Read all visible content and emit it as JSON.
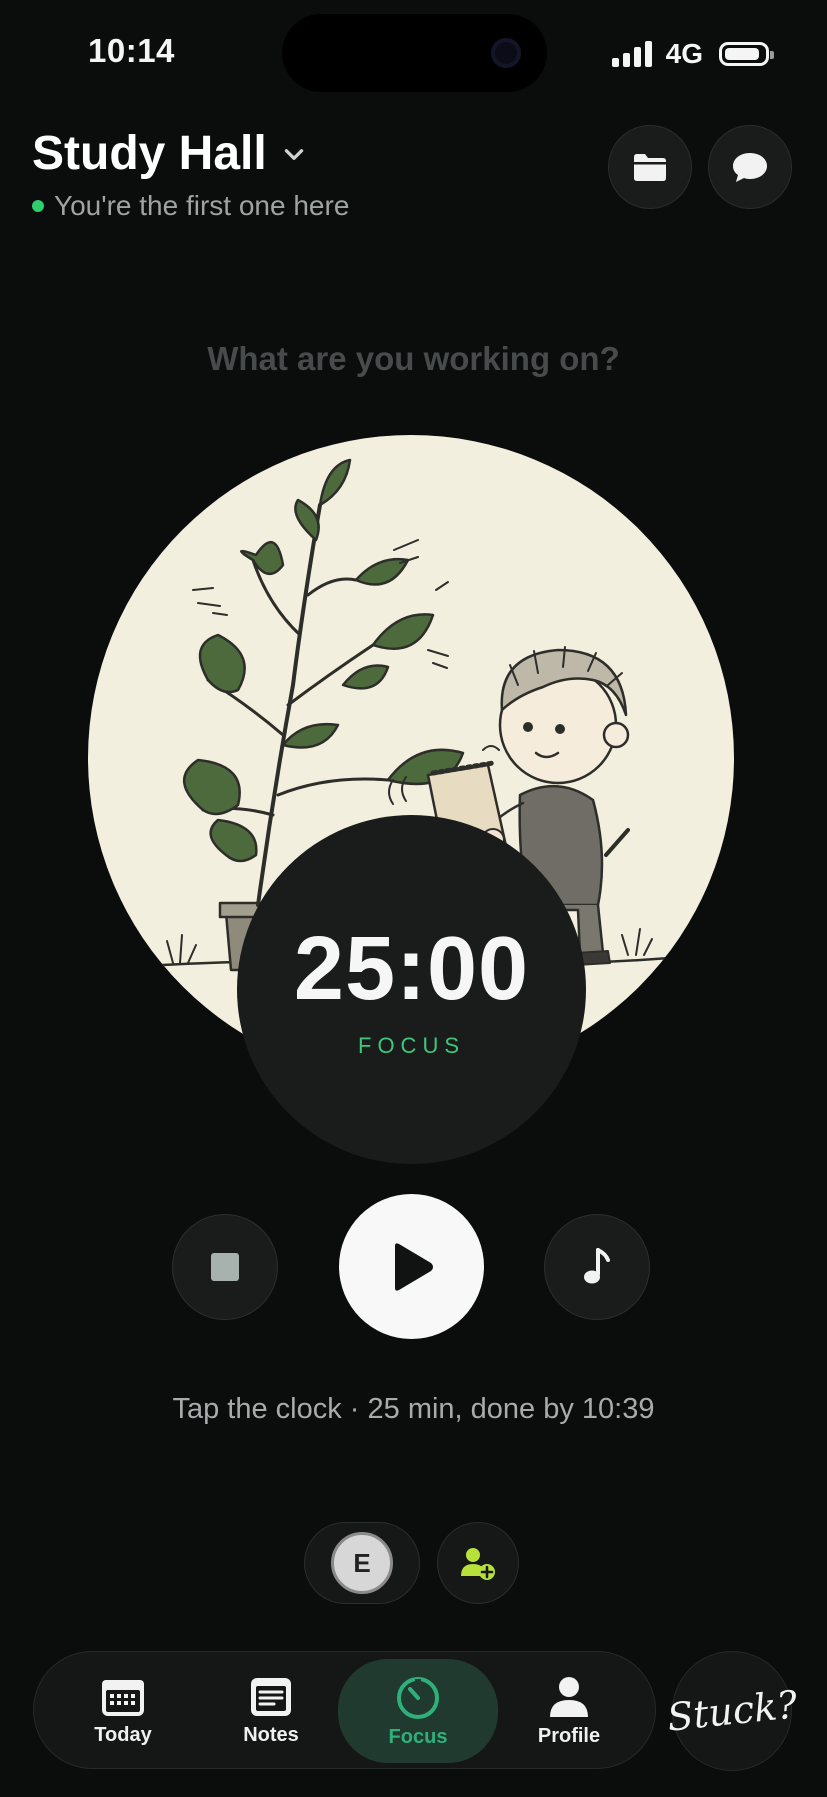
{
  "status_bar": {
    "time": "10:14",
    "network": "4G",
    "battery_level": 0.9
  },
  "header": {
    "room_title": "Study Hall",
    "presence_text": "You're the first one here",
    "presence_color": "#2fce6c"
  },
  "task_prompt": "What are you working on?",
  "timer": {
    "display": "25:00",
    "mode": "FOCUS",
    "mode_color": "#3cc87a"
  },
  "controls": {
    "stop_icon": "stop-icon",
    "play_icon": "play-icon",
    "music_icon": "music-note-icon"
  },
  "hint": "Tap the clock · 25 min, done by 10:39",
  "participants": {
    "avatar_initial": "E",
    "invite_icon": "add-person-icon",
    "invite_color": "#b6e13a"
  },
  "tabs": [
    {
      "label": "Today",
      "icon": "calendar-icon"
    },
    {
      "label": "Notes",
      "icon": "notes-icon"
    },
    {
      "label": "Focus",
      "icon": "timer-icon",
      "active": true
    },
    {
      "label": "Profile",
      "icon": "person-icon"
    }
  ],
  "stuck_button": "Stuck?"
}
